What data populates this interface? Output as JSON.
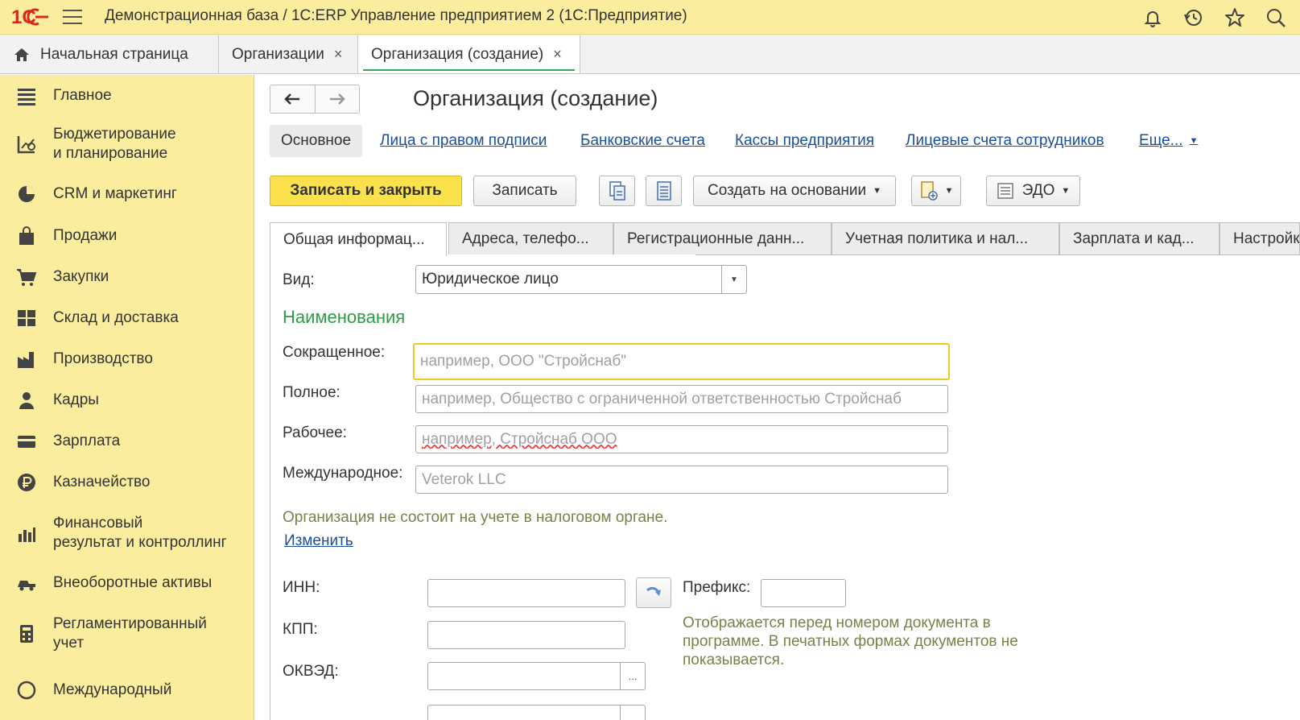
{
  "topbar": {
    "logo_text": "1С",
    "title": "Демонстрационная база / 1С:ERP Управление предприятием 2   (1С:Предприятие)",
    "icons": [
      "bell-icon",
      "history-icon",
      "star-icon",
      "search-icon"
    ]
  },
  "window_tabs": [
    {
      "label": "Начальная страница",
      "icon": "home-icon"
    },
    {
      "label": "Организации",
      "close": "×"
    },
    {
      "label": "Организация (создание)",
      "close": "×",
      "active": true
    }
  ],
  "sidebar": {
    "items": [
      {
        "label": "Главное",
        "icon": "menu-lines-icon"
      },
      {
        "label": "Бюджетирование\nи планирование",
        "icon": "budget-chart-icon"
      },
      {
        "label": "CRM и маркетинг",
        "icon": "pie-chart-icon"
      },
      {
        "label": "Продажи",
        "icon": "shopping-bag-icon"
      },
      {
        "label": "Закупки",
        "icon": "cart-icon"
      },
      {
        "label": "Склад и доставка",
        "icon": "warehouse-icon"
      },
      {
        "label": "Производство",
        "icon": "factory-icon"
      },
      {
        "label": "Кадры",
        "icon": "person-icon"
      },
      {
        "label": "Зарплата",
        "icon": "wallet-icon"
      },
      {
        "label": "Казначейство",
        "icon": "ruble-icon"
      },
      {
        "label": "Финансовый\nрезультат и контроллинг",
        "icon": "bar-chart-icon"
      },
      {
        "label": "Внеоборотные активы",
        "icon": "truck-icon"
      },
      {
        "label": "Регламентированный\nучет",
        "icon": "calculator-icon"
      },
      {
        "label": "Международный",
        "icon": "globe-icon"
      }
    ]
  },
  "form": {
    "title": "Организация (создание)",
    "nav_tabs": {
      "main": "Основное",
      "links": [
        "Лица с правом подписи",
        "Банковские счета",
        "Кассы предприятия",
        "Лицевые счета сотрудников",
        "Еще..."
      ]
    },
    "toolbar": {
      "save_close": "Записать и закрыть",
      "save": "Записать",
      "create_based": "Создать на основании",
      "edo": "ЭДО"
    },
    "page_tabs": [
      "Общая информац...",
      "Адреса, телефо...",
      "Регистрационные данн...",
      "Учетная политика и нал...",
      "Зарплата и кад...",
      "Настройк"
    ],
    "vid_label": "Вид:",
    "vid_value": "Юридическое лицо",
    "section_names": "Наименования",
    "short_label": "Сокращенное:",
    "short_placeholder": "например, ООО \"Стройснаб\"",
    "full_label": "Полное:",
    "full_placeholder": "например, Общество с ограниченной ответственностью Стройснаб",
    "work_label": "Рабочее:",
    "work_placeholder": "например, Стройснаб ООО",
    "intl_label": "Международное:",
    "intl_placeholder": "Veterok LLC",
    "tax_note": "Организация не состоит на учете в налоговом органе.",
    "change_link": "Изменить",
    "inn_label": "ИНН:",
    "kpp_label": "КПП:",
    "okved_label": "ОКВЭД:",
    "prefix_label": "Префикс:",
    "prefix_note": "Отображается перед номером документа в\nпрограмме. В печатных формах документов не\nпоказывается.",
    "dots": "..."
  },
  "colors": {
    "accent_yellow": "#fbed9e",
    "primary_button": "#fbe14c",
    "section_green": "#2f9a49",
    "link_blue": "#1a4f9c"
  }
}
